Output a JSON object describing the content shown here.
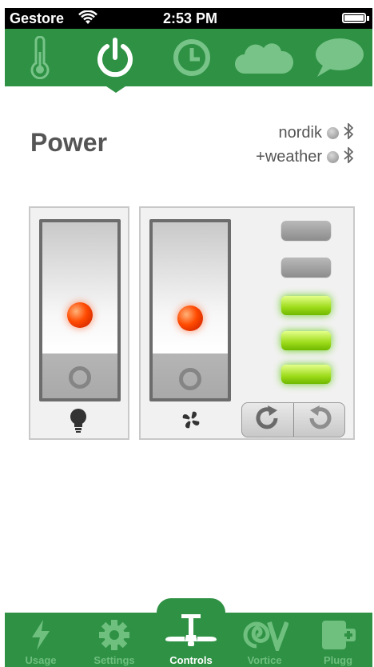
{
  "status_bar": {
    "carrier": "Gestore",
    "time": "2:53 PM"
  },
  "top_nav": {
    "tabs": [
      {
        "icon": "thermometer-icon",
        "active": false
      },
      {
        "icon": "power-icon",
        "active": true
      },
      {
        "icon": "clock-icon",
        "active": false
      },
      {
        "icon": "cloud-icon",
        "active": false
      },
      {
        "icon": "chat-bubble-icon",
        "active": false
      }
    ]
  },
  "header": {
    "title": "Power"
  },
  "devices": [
    {
      "label": "nordik",
      "bt_icon": "bluetooth-icon"
    },
    {
      "label": "+weather",
      "bt_icon": "bluetooth-icon"
    }
  ],
  "light_switch": {
    "state": "on",
    "icon": "lightbulb-icon"
  },
  "fan_switch": {
    "state": "on",
    "icon": "fan-icon"
  },
  "fan_speed": {
    "levels_total": 5,
    "levels_active": 3
  },
  "rotation": {
    "clockwise_icon": "rotate-clockwise-icon",
    "counterclockwise_icon": "rotate-counterclockwise-icon",
    "selected": "clockwise"
  },
  "bottom_tabs": [
    {
      "label": "Usage",
      "icon": "lightning-icon",
      "active": false
    },
    {
      "label": "Settings",
      "icon": "gear-icon",
      "active": false
    },
    {
      "label": "Controls",
      "icon": "ceiling-fan-icon",
      "active": true
    },
    {
      "label": "Vortice",
      "icon": "vortice-logo-icon",
      "active": false
    },
    {
      "label": "Plugg",
      "icon": "plug-add-icon",
      "active": false
    }
  ],
  "colors": {
    "brand_green": "#2e9144",
    "inactive_icon": "#6fbf7e",
    "active_icon": "#ffffff",
    "led_on": "#ff4a00",
    "level_on": "#9ddb1a",
    "level_off": "#9e9e9e"
  }
}
